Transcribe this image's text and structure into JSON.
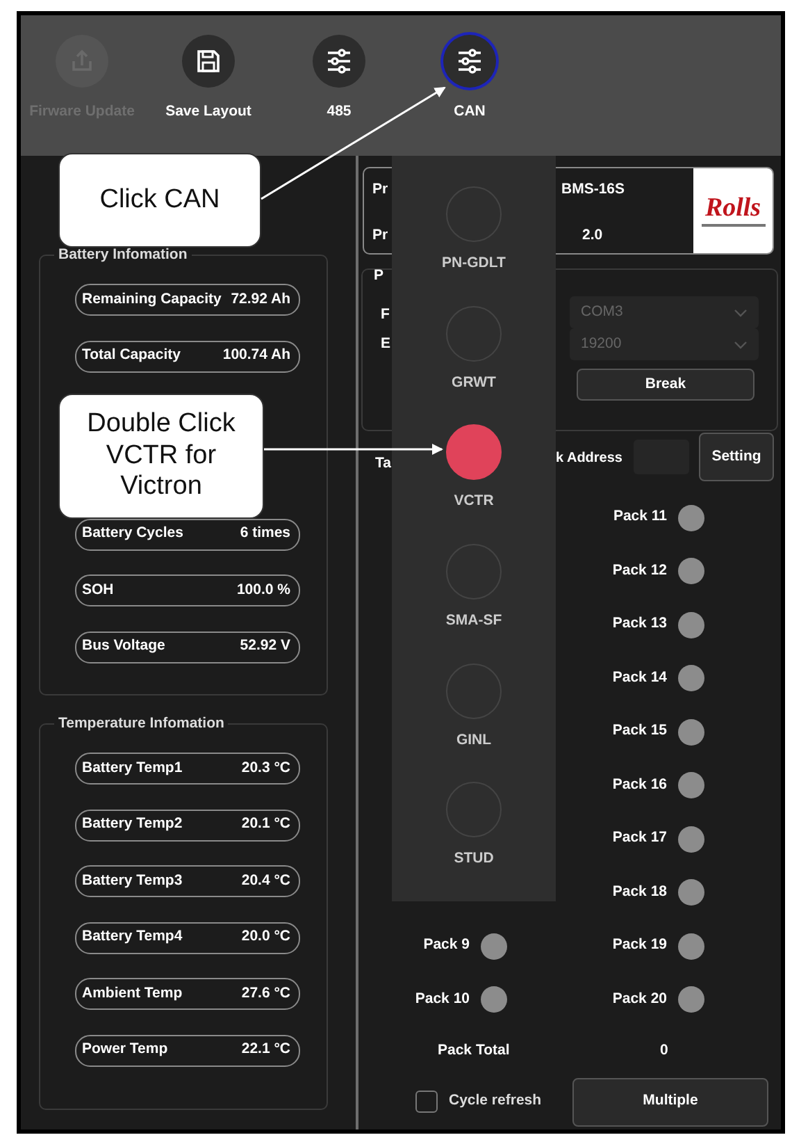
{
  "toolbar": [
    {
      "label": "Firware Update",
      "disabled": true,
      "highlighted": false
    },
    {
      "label": "Save Layout",
      "disabled": false,
      "highlighted": false
    },
    {
      "label": "485",
      "disabled": false,
      "highlighted": false
    },
    {
      "label": "CAN",
      "disabled": false,
      "highlighted": true
    }
  ],
  "battery_information": {
    "title": "Battery Infomation",
    "groups": [
      [
        {
          "label": "Remaining Capacity",
          "value": "72.92 Ah"
        },
        {
          "label": "Total Capacity",
          "value": "100.74 Ah"
        }
      ],
      [
        {
          "label": "Battery Cycles",
          "value": "6 times"
        },
        {
          "label": "SOH",
          "value": "100.0 %"
        },
        {
          "label": "Bus Voltage",
          "value": "52.92 V"
        }
      ]
    ]
  },
  "temperature_information": {
    "title": "Temperature Infomation",
    "readings": [
      {
        "label": "Battery Temp1",
        "value": "20.3 °C"
      },
      {
        "label": "Battery Temp2",
        "value": "20.1 °C"
      },
      {
        "label": "Battery Temp3",
        "value": "20.4 °C"
      },
      {
        "label": "Battery Temp4",
        "value": "20.0 °C"
      },
      {
        "label": "Ambient Temp",
        "value": "27.6 °C"
      },
      {
        "label": "Power Temp",
        "value": "22.1 °C"
      }
    ]
  },
  "device": {
    "labels": [
      "Pr",
      "Pr"
    ],
    "values": [
      "BMS-16S",
      "2.0"
    ],
    "logo": "Rolls"
  },
  "port": {
    "title": "P",
    "field_labels": [
      "F",
      "E"
    ],
    "selects": [
      {
        "value": "COM3",
        "disabled": true
      },
      {
        "value": "19200",
        "disabled": true
      }
    ],
    "button": "Break"
  },
  "address": {
    "label_start": "Ta",
    "label": "k Address",
    "button": "Setting"
  },
  "packs": {
    "left_column": [
      "Pack 9",
      "Pack 10"
    ],
    "right_column": [
      "Pack 11",
      "Pack 12",
      "Pack 13",
      "Pack 14",
      "Pack 15",
      "Pack 16",
      "Pack 17",
      "Pack 18",
      "Pack 19",
      "Pack 20"
    ],
    "total_label": "Pack Total",
    "total_value": "0"
  },
  "cycle_refresh": {
    "label": "Cycle refresh",
    "checked": false
  },
  "multiple_button": "Multiple",
  "protocols": [
    {
      "label": "PN-GDLT",
      "selected": false
    },
    {
      "label": "GRWT",
      "selected": false
    },
    {
      "label": "VCTR",
      "selected": true
    },
    {
      "label": "SMA-SF",
      "selected": false
    },
    {
      "label": "GINL",
      "selected": false
    },
    {
      "label": "STUD",
      "selected": false
    }
  ],
  "callouts": [
    {
      "text": "Click CAN"
    },
    {
      "text": "Double Click VCTR for Victron"
    }
  ]
}
